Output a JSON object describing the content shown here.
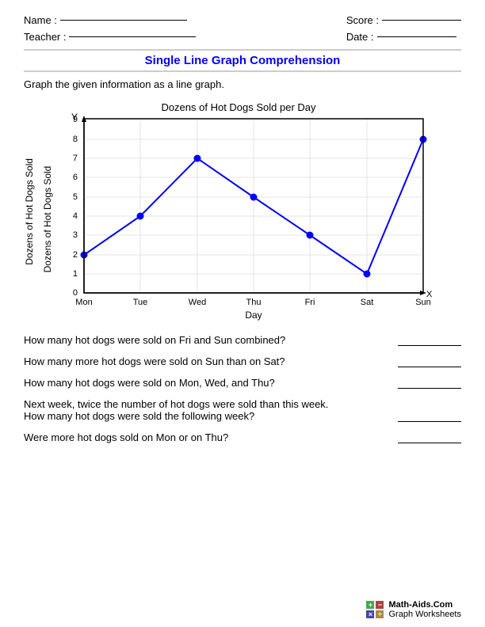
{
  "header": {
    "name_label": "Name :",
    "teacher_label": "Teacher :",
    "score_label": "Score :",
    "date_label": "Date :"
  },
  "title": "Single Line Graph Comprehension",
  "instruction": "Graph the given information as a line graph.",
  "chart": {
    "title": "Dozens of Hot Dogs Sold per Day",
    "y_label": "Dozens of Hot Dogs Sold",
    "x_label": "Day",
    "y_axis_label": "Y",
    "x_axis_label": "X",
    "x_categories": [
      "Mon",
      "Tue",
      "Wed",
      "Thu",
      "Fri",
      "Sat",
      "Sun"
    ],
    "y_values": [
      0,
      1,
      2,
      3,
      4,
      5,
      6,
      7,
      8,
      9
    ],
    "data_points": [
      {
        "day": "Mon",
        "value": 2
      },
      {
        "day": "Tue",
        "value": 4
      },
      {
        "day": "Wed",
        "value": 7
      },
      {
        "day": "Thu",
        "value": 5
      },
      {
        "day": "Fri",
        "value": 3
      },
      {
        "day": "Sat",
        "value": 1
      },
      {
        "day": "Sun",
        "value": 8
      }
    ]
  },
  "questions": [
    {
      "id": 1,
      "text": "How many hot dogs were sold on Fri and Sun combined?"
    },
    {
      "id": 2,
      "text": "How many more hot dogs were sold on Sun than on Sat?"
    },
    {
      "id": 3,
      "text": "How many hot dogs were sold on Mon, Wed, and Thu?"
    },
    {
      "id": 4,
      "text": "Next week, twice the number of hot dogs were sold than this week.\nHow many hot dogs were sold the following week?"
    },
    {
      "id": 5,
      "text": "Were more hot dogs sold on Mon or on Thu?"
    }
  ],
  "footer": {
    "site": "Math-Aids.Com",
    "subtitle": "Graph Worksheets"
  }
}
